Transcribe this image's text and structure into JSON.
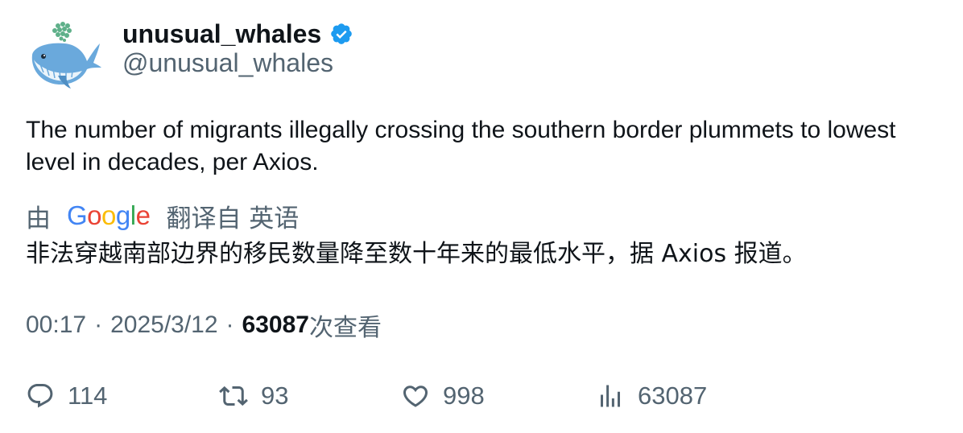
{
  "tweet": {
    "display_name": "unusual_whales",
    "handle": "@unusual_whales",
    "text": "The number of migrants illegally crossing the southern border plummets to lowest level in decades, per Axios.",
    "translation": {
      "prefix": "由",
      "provider": "Google",
      "suffix": "翻译自 英语",
      "text": "非法穿越南部边界的移民数量降至数十年来的最低水平，据 Axios 报道。"
    },
    "time": "00:17",
    "date": "2025/3/12",
    "views_count": "63087",
    "views_label": "次查看"
  },
  "actions": {
    "replies": "114",
    "retweets": "93",
    "likes": "998",
    "views": "63087"
  },
  "colors": {
    "text": "#0f1419",
    "secondary": "#536471",
    "verified": "#1d9bf0"
  }
}
